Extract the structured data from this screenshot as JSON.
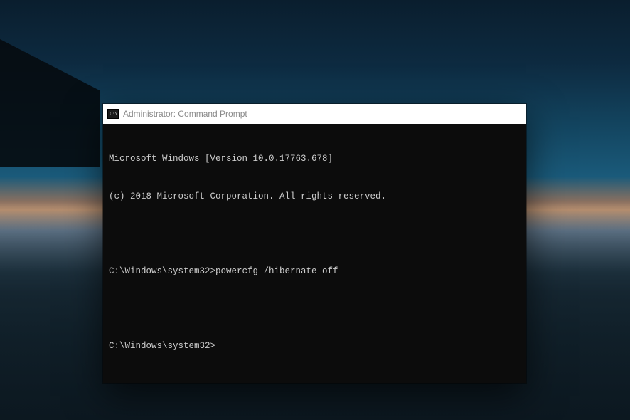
{
  "window": {
    "title": "Administrator: Command Prompt",
    "icon_glyph": "C:\\"
  },
  "terminal": {
    "banner_line1": "Microsoft Windows [Version 10.0.17763.678]",
    "banner_line2": "(c) 2018 Microsoft Corporation. All rights reserved.",
    "prompt1_path": "C:\\Windows\\system32>",
    "prompt1_command": "powercfg /hibernate off",
    "prompt2_path": "C:\\Windows\\system32>",
    "prompt2_command": ""
  }
}
